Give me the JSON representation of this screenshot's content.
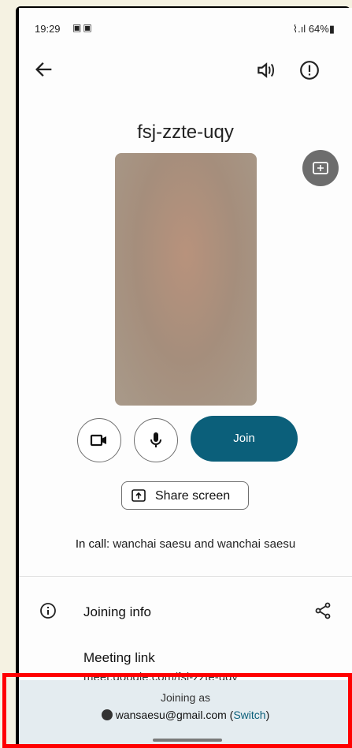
{
  "status_bar": {
    "time": "19:29",
    "battery": "64%"
  },
  "meeting": {
    "code": "fsj-zzte-uqy"
  },
  "controls": {
    "join_label": "Join",
    "share_label": "Share screen"
  },
  "in_call": {
    "prefix": "In call:",
    "participants": "wanchai saesu and wanchai saesu"
  },
  "joining_info": {
    "title": "Joining info",
    "meeting_link_label": "Meeting link",
    "meeting_link_url": "meet.google.com/fsj-zzte-uqy"
  },
  "account": {
    "joining_as_label": "Joining as",
    "email": "wansaesu@gmail.com",
    "switch_label": "Switch"
  },
  "colors": {
    "accent": "#0b5f7a",
    "highlight": "#ff0000",
    "joining_bg": "#e4ecf0"
  }
}
